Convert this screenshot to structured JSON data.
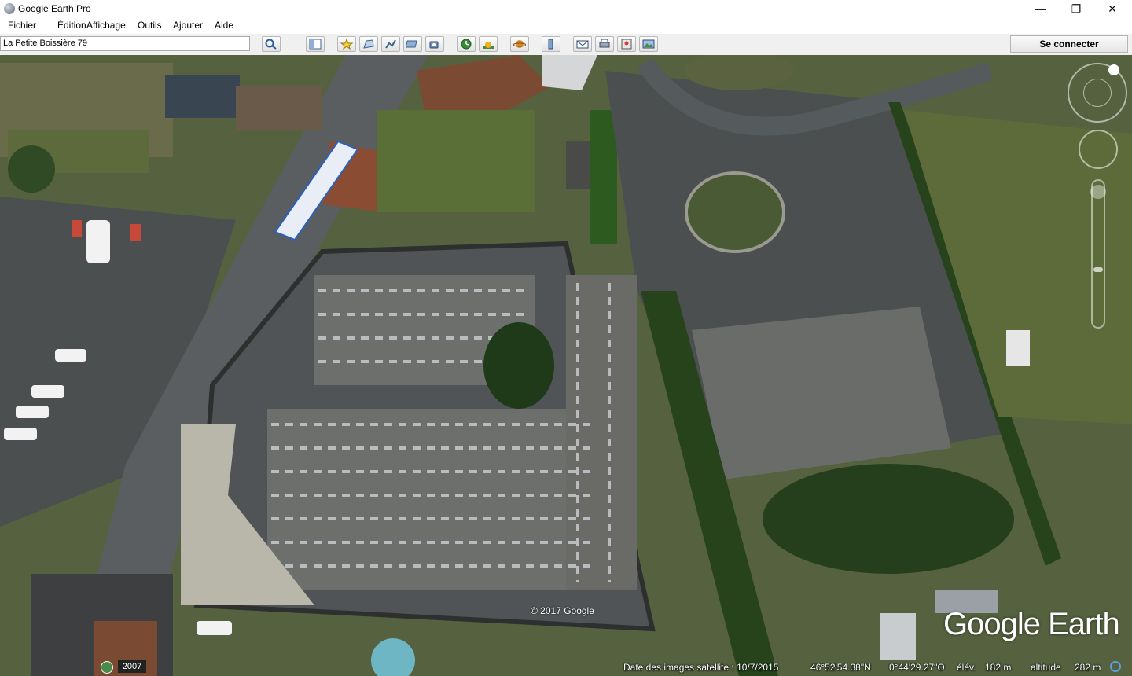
{
  "window": {
    "title": "Google Earth Pro",
    "minimize": "—",
    "maximize": "❐",
    "close": "✕"
  },
  "menu": [
    {
      "label": "Fichier"
    },
    {
      "label": "Édition"
    },
    {
      "label": "Affichage"
    },
    {
      "label": "Outils"
    },
    {
      "label": "Ajouter"
    },
    {
      "label": "Aide"
    }
  ],
  "search": {
    "value": "La Petite Boissière 79"
  },
  "toolbar": {
    "connect_label": "Se connecter"
  },
  "map": {
    "copyright": "© 2017 Google",
    "logo": "Google Earth",
    "historical_year": "2007"
  },
  "status": {
    "image_date": "Date des images satellite : 10/7/2015",
    "lat": "46°52'54.38\"N",
    "lon": "0°44'29.27\"O",
    "elev_label": "élév.",
    "elev": "182 m",
    "alt_label": "altitude",
    "alt": "282 m"
  }
}
